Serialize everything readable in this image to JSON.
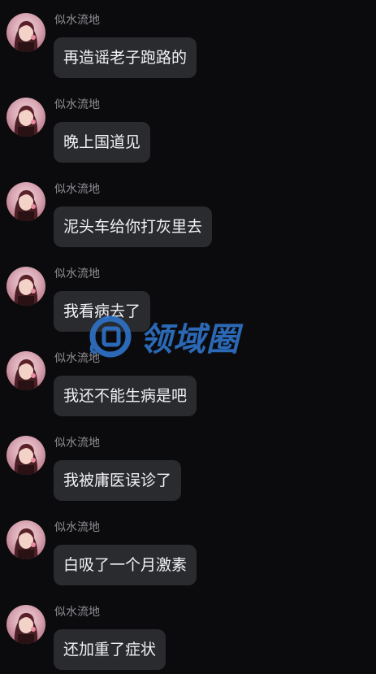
{
  "messages": [
    {
      "sender": "似水流地",
      "text": "再造谣老子跑路的"
    },
    {
      "sender": "似水流地",
      "text": "晚上国道见"
    },
    {
      "sender": "似水流地",
      "text": "泥头车给你打灰里去"
    },
    {
      "sender": "似水流地",
      "text": "我看病去了"
    },
    {
      "sender": "似水流地",
      "text": "我还不能生病是吧"
    },
    {
      "sender": "似水流地",
      "text": "我被庸医误诊了"
    },
    {
      "sender": "似水流地",
      "text": "白吸了一个月激素"
    },
    {
      "sender": "似水流地",
      "text": "还加重了症状"
    }
  ],
  "watermark": {
    "text": "领域圈"
  },
  "colors": {
    "background": "#0b0b0d",
    "bubble": "#2a2b2f",
    "sender": "#8e8e93",
    "message_text": "#f2f2f4",
    "watermark": "#2f73c8"
  }
}
